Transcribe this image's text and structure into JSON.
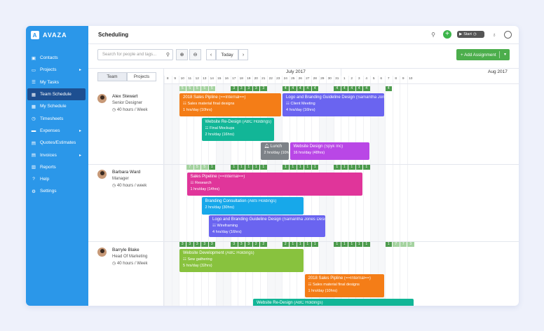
{
  "app": {
    "name": "AVAZA",
    "logo_letter": "A"
  },
  "nav": [
    {
      "label": "Contacts",
      "icon": "contacts-icon",
      "glyph": "▣",
      "chevron": ""
    },
    {
      "label": "Projects",
      "icon": "folder-icon",
      "glyph": "▭",
      "chevron": "▸"
    },
    {
      "label": "My Tasks",
      "icon": "checklist-icon",
      "glyph": "☰",
      "chevron": ""
    },
    {
      "label": "Team Schedule",
      "icon": "calendar-icon",
      "glyph": "▦",
      "chevron": "",
      "active": true
    },
    {
      "label": "My Schedule",
      "icon": "calendar-icon",
      "glyph": "▦",
      "chevron": ""
    },
    {
      "label": "Timesheets",
      "icon": "clock-icon",
      "glyph": "◷",
      "chevron": ""
    },
    {
      "label": "Expenses",
      "icon": "card-icon",
      "glyph": "▬",
      "chevron": "▸"
    },
    {
      "label": "Quotes/Estimates",
      "icon": "document-icon",
      "glyph": "▤",
      "chevron": ""
    },
    {
      "label": "Invoices",
      "icon": "invoice-icon",
      "glyph": "▤",
      "chevron": "▸"
    },
    {
      "label": "Reports",
      "icon": "chart-icon",
      "glyph": "▥",
      "chevron": ""
    },
    {
      "label": "Help",
      "icon": "help-icon",
      "glyph": "?",
      "chevron": ""
    },
    {
      "label": "Settings",
      "icon": "gear-icon",
      "glyph": "⚙",
      "chevron": ""
    }
  ],
  "header": {
    "title": "Scheduling",
    "timer_label": "Start"
  },
  "toolbar": {
    "search_placeholder": "Search for people and tags...",
    "today_label": "Today",
    "add_label": "+ Add Assignment"
  },
  "view_toggle": {
    "team": "Team",
    "projects": "Projects"
  },
  "months": [
    {
      "label": "July 2017"
    },
    {
      "label": "Aug 2017"
    }
  ],
  "days": [
    "8",
    "9",
    "10",
    "11",
    "12",
    "13",
    "14",
    "15",
    "16",
    "17",
    "18",
    "19",
    "20",
    "21",
    "22",
    "23",
    "24",
    "25",
    "26",
    "27",
    "28",
    "29",
    "30",
    "31",
    "1",
    "2",
    "3",
    "4",
    "5",
    "6",
    "7",
    "8",
    "9",
    "10"
  ],
  "weekend_pairs": [
    [
      0,
      1
    ],
    [
      7,
      8
    ],
    [
      14,
      15
    ],
    [
      21,
      22
    ],
    [
      28,
      29
    ]
  ],
  "members": [
    {
      "name": "Alex Stewart",
      "role": "Senior Designer",
      "hours": "40 hours / Week"
    },
    {
      "name": "Barbara Ward",
      "role": "Manager",
      "hours": "40 hours / week"
    },
    {
      "name": "Barryle Blake",
      "role": "Head Of Marketing",
      "hours": "40 hours / Week"
    }
  ],
  "capacity": [
    [
      {
        "d": 2,
        "v": "5",
        "c": "light"
      },
      {
        "d": 3,
        "v": "5",
        "c": "light"
      },
      {
        "d": 4,
        "v": "5",
        "c": "light"
      },
      {
        "d": 5,
        "v": "5",
        "c": "light"
      },
      {
        "d": 6,
        "v": "5",
        "c": "light"
      },
      {
        "d": 9,
        "v": "3",
        "c": "dark"
      },
      {
        "d": 10,
        "v": "3",
        "c": "dark"
      },
      {
        "d": 11,
        "v": "3",
        "c": "dark"
      },
      {
        "d": 12,
        "v": "3",
        "c": "dark"
      },
      {
        "d": 13,
        "v": "3",
        "c": "dark"
      },
      {
        "d": 16,
        "v": "4",
        "c": "dark"
      },
      {
        "d": 17,
        "v": "4",
        "c": "dark"
      },
      {
        "d": 18,
        "v": "4",
        "c": "dark"
      },
      {
        "d": 19,
        "v": "4",
        "c": "dark"
      },
      {
        "d": 20,
        "v": "4",
        "c": "dark"
      },
      {
        "d": 23,
        "v": "4",
        "c": "dark"
      },
      {
        "d": 24,
        "v": "4",
        "c": "dark"
      },
      {
        "d": 25,
        "v": "4",
        "c": "dark"
      },
      {
        "d": 26,
        "v": "4",
        "c": "dark"
      },
      {
        "d": 27,
        "v": "4",
        "c": "dark"
      },
      {
        "d": 30,
        "v": "4",
        "c": "dark"
      }
    ],
    [
      {
        "d": 3,
        "v": "7",
        "c": "light"
      },
      {
        "d": 4,
        "v": "5",
        "c": "light"
      },
      {
        "d": 5,
        "v": "5",
        "c": "light"
      },
      {
        "d": 6,
        "v": "1",
        "c": "dark"
      },
      {
        "d": 9,
        "v": "1",
        "c": "dark"
      },
      {
        "d": 10,
        "v": "1",
        "c": "dark"
      },
      {
        "d": 11,
        "v": "1",
        "c": "dark"
      },
      {
        "d": 12,
        "v": "1",
        "c": "dark"
      },
      {
        "d": 13,
        "v": "1",
        "c": "dark"
      },
      {
        "d": 16,
        "v": "1",
        "c": "dark"
      },
      {
        "d": 17,
        "v": "1",
        "c": "dark"
      },
      {
        "d": 18,
        "v": "1",
        "c": "dark"
      },
      {
        "d": 19,
        "v": "1",
        "c": "dark"
      },
      {
        "d": 20,
        "v": "1",
        "c": "dark"
      },
      {
        "d": 23,
        "v": "1",
        "c": "dark"
      },
      {
        "d": 24,
        "v": "1",
        "c": "dark"
      },
      {
        "d": 25,
        "v": "1",
        "c": "dark"
      },
      {
        "d": 26,
        "v": "1",
        "c": "dark"
      },
      {
        "d": 27,
        "v": "1",
        "c": "dark"
      }
    ],
    [
      {
        "d": 2,
        "v": "3",
        "c": "dark"
      },
      {
        "d": 3,
        "v": "3",
        "c": "dark"
      },
      {
        "d": 4,
        "v": "3",
        "c": "dark"
      },
      {
        "d": 5,
        "v": "3",
        "c": "dark"
      },
      {
        "d": 6,
        "v": "3",
        "c": "dark"
      },
      {
        "d": 9,
        "v": "3",
        "c": "dark"
      },
      {
        "d": 10,
        "v": "3",
        "c": "dark"
      },
      {
        "d": 11,
        "v": "3",
        "c": "dark"
      },
      {
        "d": 12,
        "v": "2",
        "c": "dark"
      },
      {
        "d": 13,
        "v": "2",
        "c": "dark"
      },
      {
        "d": 16,
        "v": "2",
        "c": "dark"
      },
      {
        "d": 17,
        "v": "1",
        "c": "dark"
      },
      {
        "d": 18,
        "v": "1",
        "c": "dark"
      },
      {
        "d": 19,
        "v": "1",
        "c": "dark"
      },
      {
        "d": 20,
        "v": "1",
        "c": "dark"
      },
      {
        "d": 23,
        "v": "1",
        "c": "dark"
      },
      {
        "d": 24,
        "v": "1",
        "c": "dark"
      },
      {
        "d": 25,
        "v": "1",
        "c": "dark"
      },
      {
        "d": 26,
        "v": "1",
        "c": "dark"
      },
      {
        "d": 27,
        "v": "1",
        "c": "dark"
      },
      {
        "d": 30,
        "v": "1",
        "c": "dark"
      },
      {
        "d": 31,
        "v": "7",
        "c": "light"
      },
      {
        "d": 32,
        "v": "7",
        "c": "light"
      },
      {
        "d": 33,
        "v": "3",
        "c": "light"
      }
    ]
  ],
  "assignments": [
    {
      "row": 0,
      "lane": 0,
      "start": 2,
      "end": 16,
      "color": "#f47d17",
      "title": "2018 Sales Pipline",
      "client": "(==Internal==)",
      "task": "Sales material final designs",
      "hours": "1 hrs/day (10hrs)",
      "icon": "task-icon"
    },
    {
      "row": 0,
      "lane": 0,
      "start": 16,
      "end": 30,
      "color": "#6a64f0",
      "title": "Logo and Branding Guideline Design",
      "client": "(Samantha Jones Designs)",
      "task": "Client Meeting",
      "hours": "4 hrs/day (16hrs)",
      "icon": "task-icon"
    },
    {
      "row": 0,
      "lane": 1,
      "start": 5,
      "end": 15,
      "color": "#12b697",
      "title": "Website Re-Design",
      "client": "(ABC Holdings)",
      "task": "Final Mockups",
      "hours": "2 hrs/day (16hrs)",
      "icon": "task-icon"
    },
    {
      "row": 0,
      "lane": 2,
      "start": 13,
      "end": 17,
      "color": "#7d8288",
      "title": "Lunch",
      "client": "",
      "task": "",
      "hours": "2 hrs/day (10hrs)",
      "icon": "bell-icon"
    },
    {
      "row": 0,
      "lane": 2,
      "start": 17,
      "end": 28,
      "color": "#b947e6",
      "title": "Website Design",
      "client": "(Spyk Inc)",
      "task": "",
      "hours": "16 hrs/day (48hrs)",
      "icon": ""
    },
    {
      "row": 1,
      "lane": 0,
      "start": 3,
      "end": 27,
      "color": "#e0359a",
      "title": "Sales Pipeline",
      "client": "(==Internal==)",
      "task": "Research",
      "hours": "1 hrs/day (14hrs)",
      "icon": "task-icon"
    },
    {
      "row": 1,
      "lane": 1,
      "start": 5,
      "end": 19,
      "color": "#17a8ea",
      "title": "Branding Consultation",
      "client": "(ABS Holdings)",
      "task": "",
      "hours": "2 hrs/day (30hrs)",
      "icon": ""
    },
    {
      "row": 1,
      "lane": 2,
      "start": 6,
      "end": 22,
      "color": "#6a64f0",
      "title": "Logo and Branding Guideline Design",
      "client": "(Samantha Jones Designs)",
      "task": "Wireframing",
      "hours": "4 hrs/day (16hrs)",
      "icon": "task-icon"
    },
    {
      "row": 2,
      "lane": 0,
      "start": 2,
      "end": 19,
      "color": "#88c23e",
      "title": "Website Development",
      "client": "(ABC Holdings)",
      "task": "Sew gathering",
      "hours": "5 hrs/day (32hrs)",
      "icon": "task-icon"
    },
    {
      "row": 2,
      "lane": 1,
      "start": 19,
      "end": 30,
      "color": "#f47d17",
      "title": "2018 Sales Pipline",
      "client": "(==Internal==)",
      "task": "Sales material final designs",
      "hours": "1 hrs/day (10hrs)",
      "icon": "task-icon"
    },
    {
      "row": 2,
      "lane": 2,
      "start": 12,
      "end": 34,
      "color": "#12b697",
      "title": "Website Re-Design",
      "client": "(ABC Holdings)",
      "task": "",
      "hours": "",
      "icon": ""
    }
  ]
}
